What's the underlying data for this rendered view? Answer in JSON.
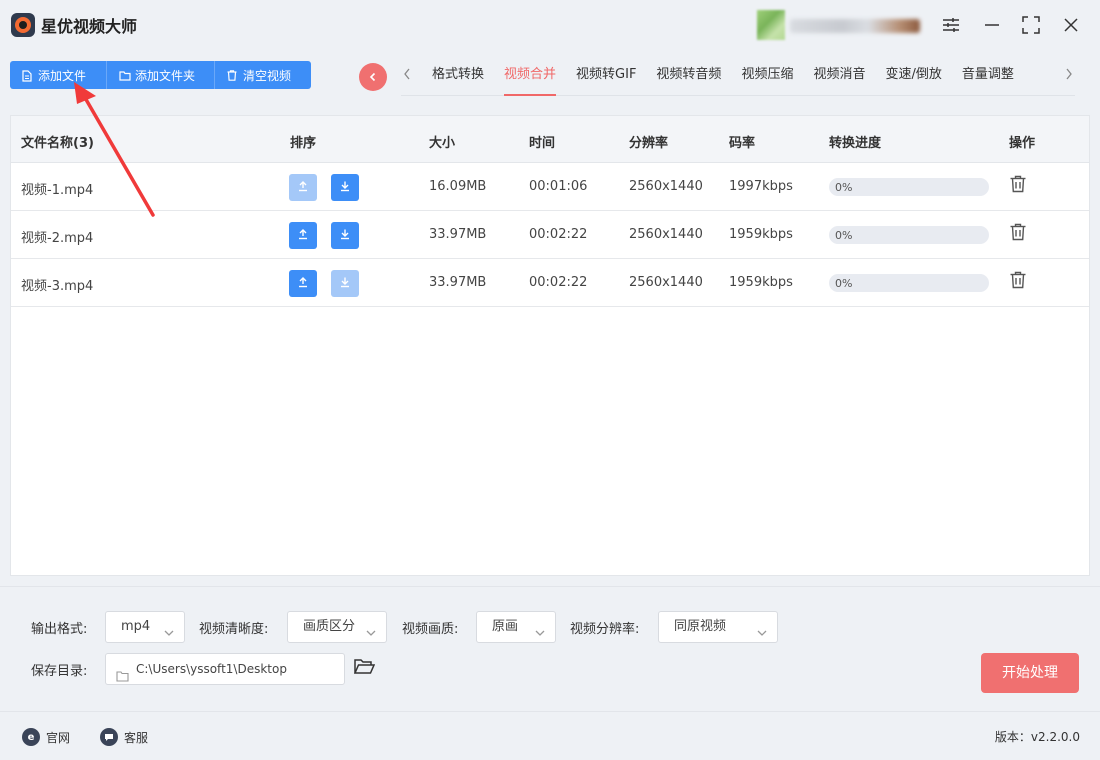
{
  "app": {
    "title": "星优视频大师"
  },
  "user": {
    "name": "username"
  },
  "toolbar": {
    "add_file": "添加文件",
    "add_folder": "添加文件夹",
    "clear": "清空视频"
  },
  "tabs": [
    {
      "label": "格式转换",
      "active": false
    },
    {
      "label": "视频合并",
      "active": true
    },
    {
      "label": "视频转GIF",
      "active": false
    },
    {
      "label": "视频转音频",
      "active": false
    },
    {
      "label": "视频压缩",
      "active": false
    },
    {
      "label": "视频消音",
      "active": false
    },
    {
      "label": "变速/倒放",
      "active": false
    },
    {
      "label": "音量调整",
      "active": false
    }
  ],
  "table": {
    "headers": {
      "name": "文件名称(3)",
      "sort": "排序",
      "size": "大小",
      "time": "时间",
      "resolution": "分辨率",
      "bitrate": "码率",
      "progress": "转换进度",
      "action": "操作"
    },
    "rows": [
      {
        "name": "视频-1.mp4",
        "size": "16.09MB",
        "time": "00:01:06",
        "resolution": "2560x1440",
        "bitrate": "1997kbps",
        "progress": 0,
        "progress_label": "0%",
        "up_enabled": false,
        "down_enabled": true
      },
      {
        "name": "视频-2.mp4",
        "size": "33.97MB",
        "time": "00:02:22",
        "resolution": "2560x1440",
        "bitrate": "1959kbps",
        "progress": 0,
        "progress_label": "0%",
        "up_enabled": true,
        "down_enabled": true
      },
      {
        "name": "视频-3.mp4",
        "size": "33.97MB",
        "time": "00:02:22",
        "resolution": "2560x1440",
        "bitrate": "1959kbps",
        "progress": 0,
        "progress_label": "0%",
        "up_enabled": true,
        "down_enabled": false
      }
    ]
  },
  "settings": {
    "format_label": "输出格式:",
    "format_value": "mp4",
    "clarity_label": "视频清晰度:",
    "clarity_value": "画质区分",
    "quality_label": "视频画质:",
    "quality_value": "原画",
    "resolution_label": "视频分辨率:",
    "resolution_value": "同原视频",
    "dir_label": "保存目录:",
    "dir_value": "C:\\Users\\yssoft1\\Desktop",
    "start": "开始处理"
  },
  "footer": {
    "website": "官网",
    "support": "客服",
    "version": "版本：v2.2.0.0"
  },
  "colors": {
    "accent_blue": "#3d8ef7",
    "accent_red": "#f07070",
    "annotation_arrow": "#f03a3a"
  }
}
